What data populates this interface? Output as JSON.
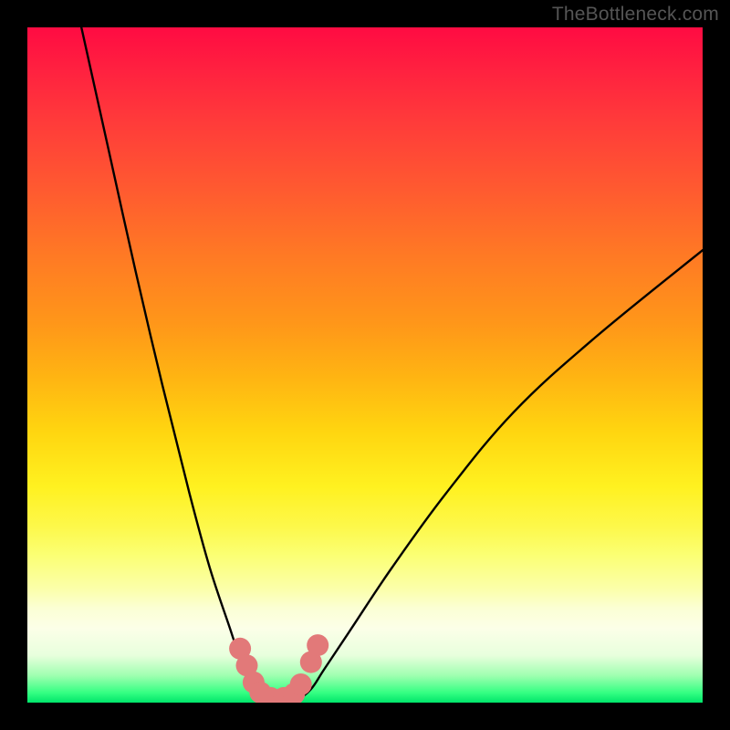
{
  "watermark": {
    "text": "TheBottleneck.com"
  },
  "chart_data": {
    "type": "line",
    "title": "",
    "xlabel": "",
    "ylabel": "",
    "xlim": [
      0,
      100
    ],
    "ylim": [
      0,
      100
    ],
    "background_gradient": {
      "top_color": "#ff0b42",
      "mid_color": "#ffd610",
      "bottom_color": "#00e56a"
    },
    "series": [
      {
        "name": "left-curve",
        "x": [
          8,
          12,
          16,
          20,
          24,
          27,
          30,
          32,
          33.5,
          34.5
        ],
        "y": [
          100,
          82,
          64,
          47,
          31,
          20,
          11,
          5,
          2,
          0.5
        ]
      },
      {
        "name": "right-curve",
        "x": [
          40,
          42,
          44,
          48,
          54,
          62,
          72,
          84,
          100
        ],
        "y": [
          0.5,
          2,
          5,
          11,
          20,
          31,
          43,
          54,
          67
        ]
      },
      {
        "name": "valley-floor",
        "x": [
          34.5,
          36,
          38,
          40
        ],
        "y": [
          0.5,
          0,
          0,
          0.5
        ]
      }
    ],
    "markers": {
      "name": "highlight-dots",
      "color": "#e27979",
      "points": [
        {
          "x": 31.5,
          "y": 8.0
        },
        {
          "x": 32.5,
          "y": 5.5
        },
        {
          "x": 33.5,
          "y": 3.0
        },
        {
          "x": 34.5,
          "y": 1.5
        },
        {
          "x": 36.0,
          "y": 0.7
        },
        {
          "x": 38.0,
          "y": 0.7
        },
        {
          "x": 39.5,
          "y": 1.3
        },
        {
          "x": 40.5,
          "y": 2.7
        },
        {
          "x": 42.0,
          "y": 6.0
        },
        {
          "x": 43.0,
          "y": 8.5
        }
      ]
    }
  }
}
